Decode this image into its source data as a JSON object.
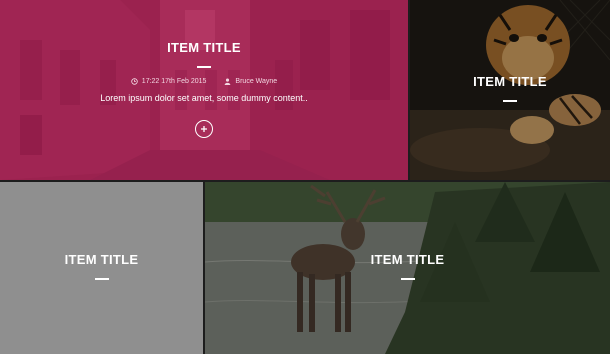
{
  "tiles": {
    "city": {
      "title": "ITEM TITLE",
      "time": "17:22 17th Feb 2015",
      "author": "Bruce Wayne",
      "excerpt": "Lorem ipsum dolor set amet, some dummy content..",
      "overlay_color": "#b4205a"
    },
    "tiger": {
      "title": "ITEM TITLE"
    },
    "gray": {
      "title": "ITEM TITLE",
      "background": "#8f8f8f"
    },
    "deer": {
      "title": "ITEM TITLE"
    }
  },
  "icons": {
    "time": "clock-icon",
    "author": "user-icon",
    "more": "plus-icon"
  }
}
